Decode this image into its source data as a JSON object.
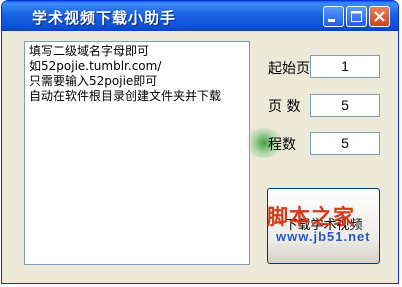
{
  "window": {
    "title": "学术视频下载小助手",
    "controls": [
      "minimize",
      "maximize",
      "close"
    ]
  },
  "memo": {
    "lines": [
      "填写二级域名字母即可",
      "如52pojie.tumblr.com/",
      "只需要输入52pojie即可",
      "自动在软件根目录创建文件夹并下载"
    ]
  },
  "form": {
    "start_page_label": "起始页",
    "start_page_value": "1",
    "pages_label": "页  数",
    "pages_value": "5",
    "threads_label_visible": "程数",
    "threads_value": "5"
  },
  "download_button": {
    "label_visible": "下载学术视频"
  },
  "watermark": {
    "text": "脚本之家",
    "url": "www.jb51.net"
  },
  "colors": {
    "titlebar": "#0a4fd6",
    "window_bg": "#ece9d8",
    "close_button": "#c9431a",
    "watermark_red": "#d43a1a",
    "watermark_blue": "#2a55c8"
  }
}
